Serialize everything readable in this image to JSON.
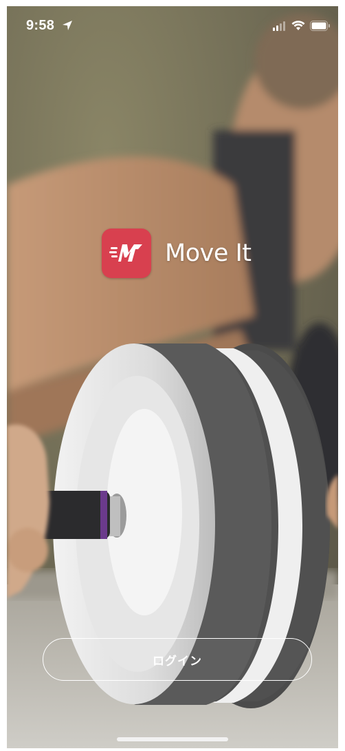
{
  "status_bar": {
    "time": "9:58",
    "location_icon": "location-arrow-icon",
    "signal_icon": "cellular-signal-icon",
    "wifi_icon": "wifi-icon",
    "battery_icon": "battery-icon"
  },
  "brand": {
    "app_name": "Move It",
    "logo_icon": "move-it-logo-icon",
    "accent_color": "#d8404f"
  },
  "actions": {
    "login_label": "ログイン"
  },
  "background": {
    "image": "person-exercising-with-ab-roller-photo"
  }
}
